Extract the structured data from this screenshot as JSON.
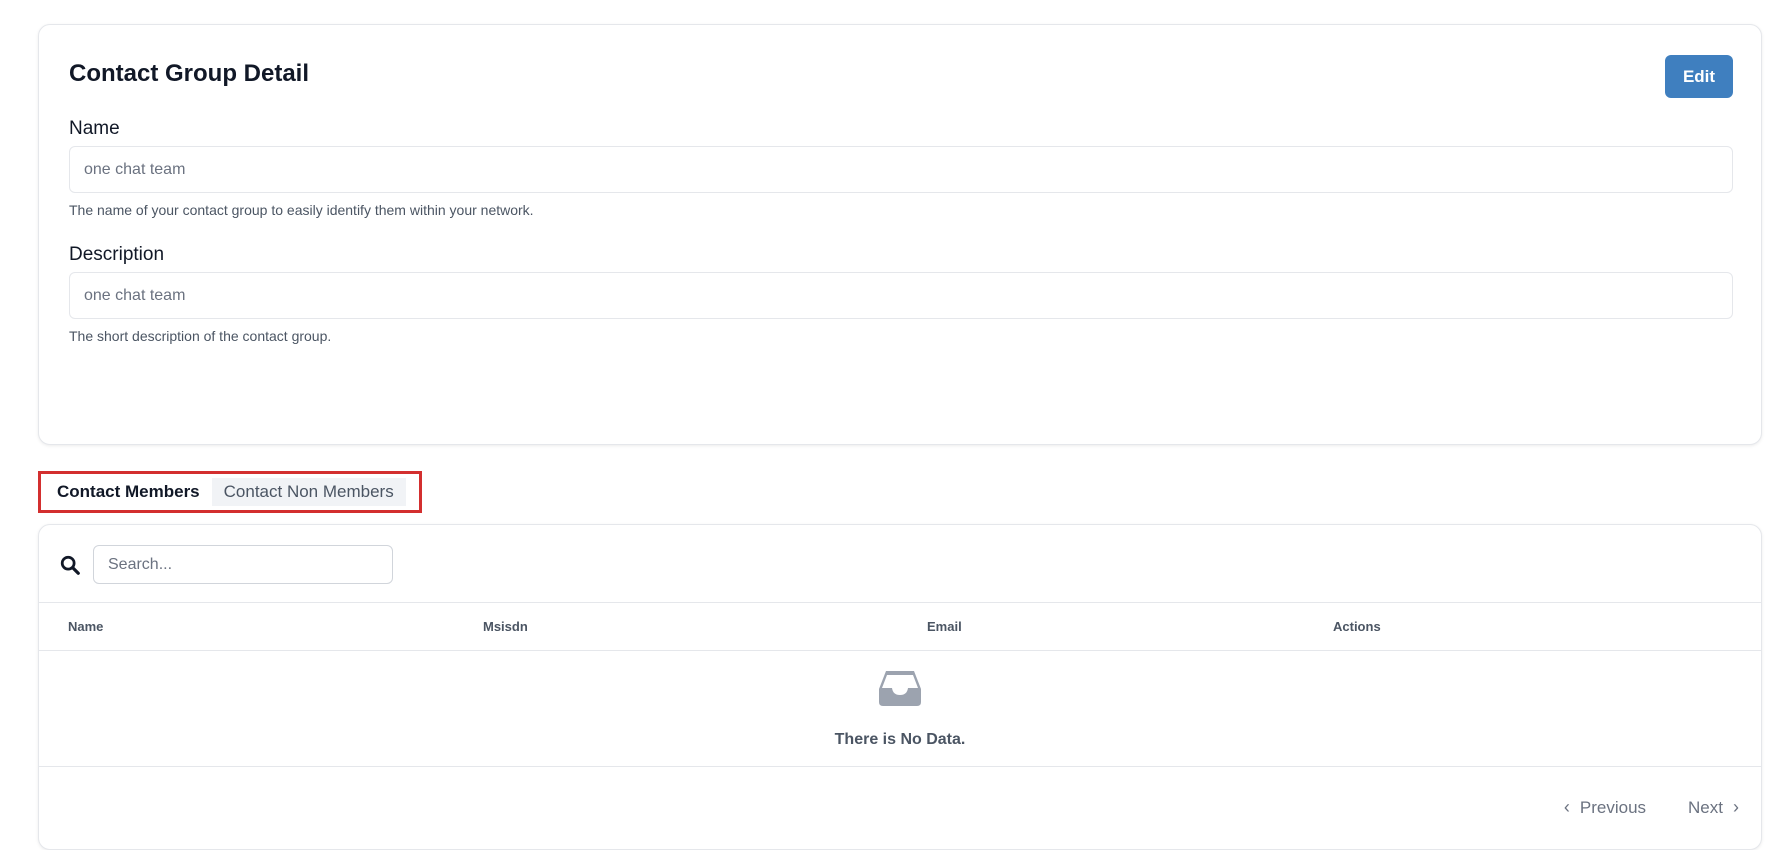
{
  "detail": {
    "title": "Contact Group Detail",
    "edit_label": "Edit",
    "name_label": "Name",
    "name_value": "one chat team",
    "name_help": "The name of your contact group to easily identify them within your network.",
    "description_label": "Description",
    "description_value": "one chat team",
    "description_help": "The short description of the contact group."
  },
  "tabs": {
    "members": "Contact Members",
    "non_members": "Contact Non Members",
    "active": "members"
  },
  "members": {
    "search_placeholder": "Search...",
    "columns": [
      "Name",
      "Msisdn",
      "Email",
      "Actions"
    ],
    "empty_text": "There is No Data.",
    "pagination": {
      "previous": "Previous",
      "next": "Next"
    }
  },
  "colors": {
    "accent": "#3f7fbf",
    "highlight_border": "#d32f2f"
  }
}
